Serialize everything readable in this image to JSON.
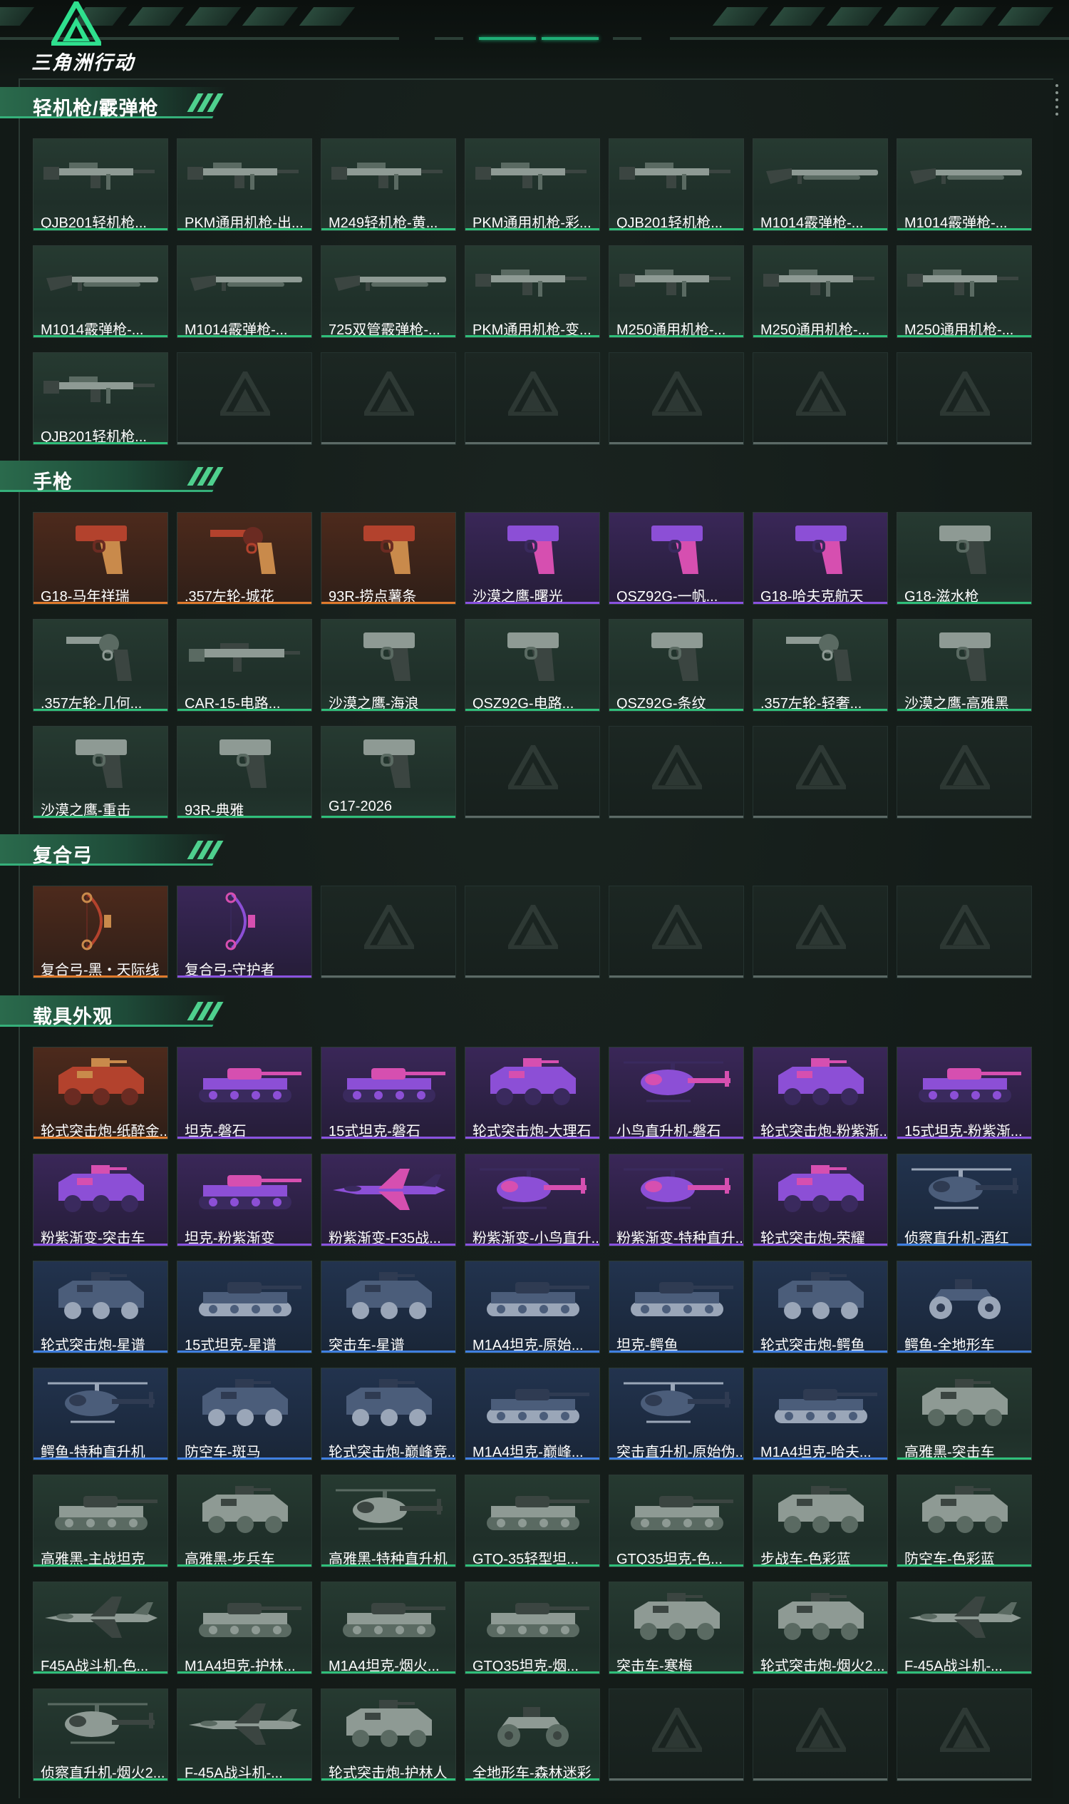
{
  "app": {
    "logo_text": "三角洲行动"
  },
  "sections": [
    {
      "title": "轻机枪/霰弹枪",
      "items": [
        {
          "label": "QJB201轻机枪...",
          "rarity": "green",
          "icon": "lmg-icon"
        },
        {
          "label": "PKM通用机枪-出...",
          "rarity": "green",
          "icon": "lmg-icon"
        },
        {
          "label": "M249轻机枪-黄...",
          "rarity": "green",
          "icon": "lmg-icon"
        },
        {
          "label": "PKM通用机枪-彩...",
          "rarity": "green",
          "icon": "lmg-icon"
        },
        {
          "label": "QJB201轻机枪...",
          "rarity": "green",
          "icon": "lmg-icon"
        },
        {
          "label": "M1014霰弹枪-...",
          "rarity": "green",
          "icon": "shotgun-icon"
        },
        {
          "label": "M1014霰弹枪-...",
          "rarity": "green",
          "icon": "shotgun-icon"
        },
        {
          "label": "M1014霰弹枪-...",
          "rarity": "green",
          "icon": "shotgun-icon"
        },
        {
          "label": "M1014霰弹枪-...",
          "rarity": "green",
          "icon": "shotgun-icon"
        },
        {
          "label": "725双管霰弹枪-...",
          "rarity": "green",
          "icon": "shotgun-icon"
        },
        {
          "label": "PKM通用机枪-变...",
          "rarity": "green",
          "icon": "lmg-icon"
        },
        {
          "label": "M250通用机枪-...",
          "rarity": "green",
          "icon": "lmg-icon"
        },
        {
          "label": "M250通用机枪-...",
          "rarity": "green",
          "icon": "lmg-icon"
        },
        {
          "label": "M250通用机枪-...",
          "rarity": "green",
          "icon": "lmg-icon"
        },
        {
          "label": "QJB201轻机枪...",
          "rarity": "green",
          "icon": "lmg-icon"
        },
        {
          "label": "",
          "rarity": "empty"
        },
        {
          "label": "",
          "rarity": "empty"
        },
        {
          "label": "",
          "rarity": "empty"
        },
        {
          "label": "",
          "rarity": "empty"
        },
        {
          "label": "",
          "rarity": "empty"
        },
        {
          "label": "",
          "rarity": "empty"
        }
      ]
    },
    {
      "title": "手枪",
      "items": [
        {
          "label": "G18-马年祥瑞",
          "rarity": "orange",
          "icon": "pistol-icon"
        },
        {
          "label": ".357左轮-城花",
          "rarity": "orange",
          "icon": "revolver-icon"
        },
        {
          "label": "93R-捞点薯条",
          "rarity": "orange",
          "icon": "pistol-icon"
        },
        {
          "label": "沙漠之鹰-曙光",
          "rarity": "purple",
          "icon": "pistol-icon"
        },
        {
          "label": "QSZ92G-一帆...",
          "rarity": "purple",
          "icon": "pistol-icon"
        },
        {
          "label": "G18-哈夫克航天",
          "rarity": "purple",
          "icon": "pistol-icon"
        },
        {
          "label": "G18-滋水枪",
          "rarity": "green",
          "icon": "pistol-icon"
        },
        {
          "label": ".357左轮-几何...",
          "rarity": "green",
          "icon": "revolver-icon"
        },
        {
          "label": "CAR-15-电路...",
          "rarity": "green",
          "icon": "rifle-icon"
        },
        {
          "label": "沙漠之鹰-海浪",
          "rarity": "green",
          "icon": "pistol-icon"
        },
        {
          "label": "QSZ92G-电路...",
          "rarity": "green",
          "icon": "pistol-icon"
        },
        {
          "label": "QSZ92G-条纹",
          "rarity": "green",
          "icon": "pistol-icon"
        },
        {
          "label": ".357左轮-轻奢...",
          "rarity": "green",
          "icon": "revolver-icon"
        },
        {
          "label": "沙漠之鹰-高雅黑",
          "rarity": "green",
          "icon": "pistol-icon"
        },
        {
          "label": "沙漠之鹰-重击",
          "rarity": "green",
          "icon": "pistol-icon"
        },
        {
          "label": "93R-典雅",
          "rarity": "green",
          "icon": "pistol-icon"
        },
        {
          "label": "G17-2026",
          "rarity": "green",
          "icon": "pistol-icon"
        },
        {
          "label": "",
          "rarity": "empty"
        },
        {
          "label": "",
          "rarity": "empty"
        },
        {
          "label": "",
          "rarity": "empty"
        },
        {
          "label": "",
          "rarity": "empty"
        }
      ]
    },
    {
      "title": "复合弓",
      "items": [
        {
          "label": "复合弓-黑・天际线",
          "rarity": "orange",
          "icon": "bow-icon"
        },
        {
          "label": "复合弓-守护者",
          "rarity": "purple",
          "icon": "bow-icon"
        },
        {
          "label": "",
          "rarity": "empty"
        },
        {
          "label": "",
          "rarity": "empty"
        },
        {
          "label": "",
          "rarity": "empty"
        },
        {
          "label": "",
          "rarity": "empty"
        },
        {
          "label": "",
          "rarity": "empty"
        }
      ]
    },
    {
      "title": "载具外观",
      "items": [
        {
          "label": "轮式突击炮-纸醉金...",
          "rarity": "orange",
          "icon": "armored-car-icon"
        },
        {
          "label": "坦克-磐石",
          "rarity": "purple",
          "icon": "tank-icon"
        },
        {
          "label": "15式坦克-磐石",
          "rarity": "purple",
          "icon": "tank-icon"
        },
        {
          "label": "轮式突击炮-大理石",
          "rarity": "purple",
          "icon": "armored-car-icon"
        },
        {
          "label": "小鸟直升机-磐石",
          "rarity": "purple",
          "icon": "helicopter-icon"
        },
        {
          "label": "轮式突击炮-粉紫渐...",
          "rarity": "purple",
          "icon": "armored-car-icon"
        },
        {
          "label": "15式坦克-粉紫渐...",
          "rarity": "purple",
          "icon": "tank-icon"
        },
        {
          "label": "粉紫渐变-突击车",
          "rarity": "purple",
          "icon": "armored-car-icon"
        },
        {
          "label": "坦克-粉紫渐变",
          "rarity": "purple",
          "icon": "tank-icon"
        },
        {
          "label": "粉紫渐变-F35战...",
          "rarity": "purple",
          "icon": "jet-icon"
        },
        {
          "label": "粉紫渐变-小鸟直升...",
          "rarity": "purple",
          "icon": "helicopter-icon"
        },
        {
          "label": "粉紫渐变-特种直升...",
          "rarity": "purple",
          "icon": "helicopter-icon"
        },
        {
          "label": "轮式突击炮-荣耀",
          "rarity": "purple",
          "icon": "armored-car-icon"
        },
        {
          "label": "侦察直升机-酒红",
          "rarity": "blue",
          "icon": "helicopter-icon"
        },
        {
          "label": "轮式突击炮-星谱",
          "rarity": "blue",
          "icon": "armored-car-icon"
        },
        {
          "label": "15式坦克-星谱",
          "rarity": "blue",
          "icon": "tank-icon"
        },
        {
          "label": "突击车-星谱",
          "rarity": "blue",
          "icon": "armored-car-icon"
        },
        {
          "label": "M1A4坦克-原始...",
          "rarity": "blue",
          "icon": "tank-icon"
        },
        {
          "label": "坦克-鳄鱼",
          "rarity": "blue",
          "icon": "tank-icon"
        },
        {
          "label": "轮式突击炮-鳄鱼",
          "rarity": "blue",
          "icon": "armored-car-icon"
        },
        {
          "label": "鳄鱼-全地形车",
          "rarity": "blue",
          "icon": "atv-icon"
        },
        {
          "label": "鳄鱼-特种直升机",
          "rarity": "blue",
          "icon": "helicopter-icon"
        },
        {
          "label": "防空车-斑马",
          "rarity": "blue",
          "icon": "armored-car-icon"
        },
        {
          "label": "轮式突击炮-巅峰竞...",
          "rarity": "blue",
          "icon": "armored-car-icon"
        },
        {
          "label": "M1A4坦克-巅峰...",
          "rarity": "blue",
          "icon": "tank-icon"
        },
        {
          "label": "突击直升机-原始伪...",
          "rarity": "blue",
          "icon": "helicopter-icon"
        },
        {
          "label": "M1A4坦克-哈夫...",
          "rarity": "blue",
          "icon": "tank-icon"
        },
        {
          "label": "高雅黑-突击车",
          "rarity": "green",
          "icon": "armored-car-icon"
        },
        {
          "label": "高雅黑-主战坦克",
          "rarity": "green",
          "icon": "tank-icon"
        },
        {
          "label": "高雅黑-步兵车",
          "rarity": "green",
          "icon": "armored-car-icon"
        },
        {
          "label": "高雅黑-特种直升机",
          "rarity": "green",
          "icon": "helicopter-icon"
        },
        {
          "label": "GTQ-35轻型坦...",
          "rarity": "green",
          "icon": "tank-icon"
        },
        {
          "label": "GTQ35坦克-色...",
          "rarity": "green",
          "icon": "tank-icon"
        },
        {
          "label": "步战车-色彩蓝",
          "rarity": "green",
          "icon": "armored-car-icon"
        },
        {
          "label": "防空车-色彩蓝",
          "rarity": "green",
          "icon": "armored-car-icon"
        },
        {
          "label": "F45A战斗机-色...",
          "rarity": "green",
          "icon": "jet-icon"
        },
        {
          "label": "M1A4坦克-护林...",
          "rarity": "green",
          "icon": "tank-icon"
        },
        {
          "label": "M1A4坦克-烟火...",
          "rarity": "green",
          "icon": "tank-icon"
        },
        {
          "label": "GTQ35坦克-烟...",
          "rarity": "green",
          "icon": "tank-icon"
        },
        {
          "label": "突击车-寒梅",
          "rarity": "green",
          "icon": "armored-car-icon"
        },
        {
          "label": "轮式突击炮-烟火2...",
          "rarity": "green",
          "icon": "armored-car-icon"
        },
        {
          "label": "F-45A战斗机-...",
          "rarity": "green",
          "icon": "jet-icon"
        },
        {
          "label": "侦察直升机-烟火2...",
          "rarity": "green",
          "icon": "helicopter-icon"
        },
        {
          "label": "F-45A战斗机-...",
          "rarity": "green",
          "icon": "jet-icon"
        },
        {
          "label": "轮式突击炮-护林人",
          "rarity": "green",
          "icon": "armored-car-icon"
        },
        {
          "label": "全地形车-森林迷彩",
          "rarity": "green",
          "icon": "atv-icon"
        },
        {
          "label": "",
          "rarity": "empty"
        },
        {
          "label": "",
          "rarity": "empty"
        },
        {
          "label": "",
          "rarity": "empty"
        }
      ]
    }
  ],
  "colors": {
    "accent": "#2fbf7a",
    "orange": "#e07a2c",
    "purple": "#8a52e0",
    "blue": "#3f7fe0",
    "empty": "#5c6a66"
  }
}
